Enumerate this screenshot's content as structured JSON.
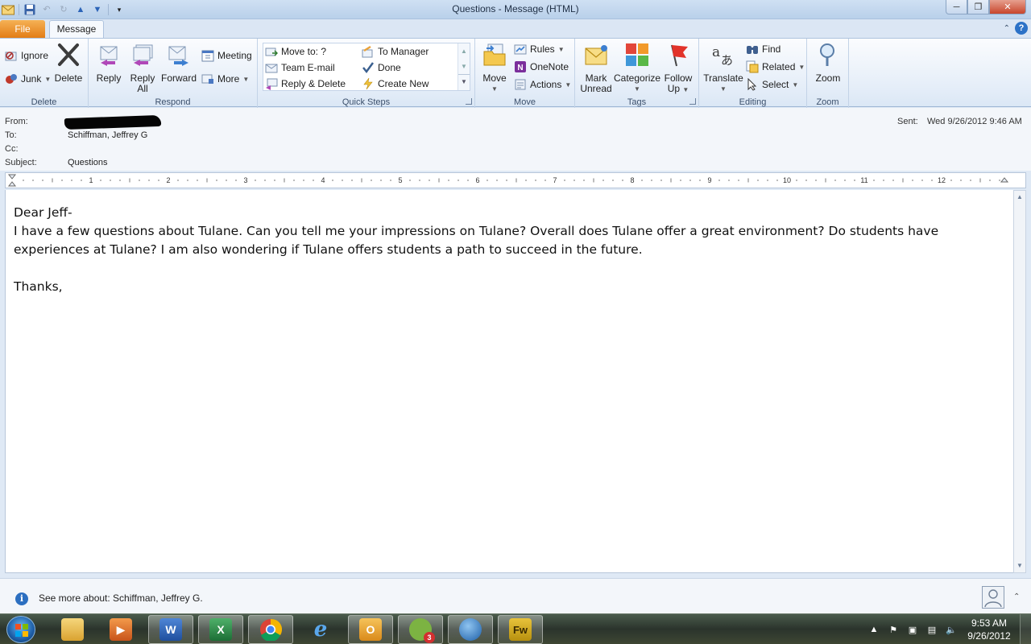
{
  "window": {
    "title": "Questions  -  Message (HTML)"
  },
  "tabs": {
    "file": "File",
    "message": "Message"
  },
  "ribbon": {
    "delete_group": {
      "label": "Delete",
      "ignore": "Ignore",
      "junk": "Junk",
      "delete": "Delete"
    },
    "respond_group": {
      "label": "Respond",
      "reply": "Reply",
      "reply_all_1": "Reply",
      "reply_all_2": "All",
      "forward": "Forward",
      "meeting": "Meeting",
      "more": "More"
    },
    "quick_steps_group": {
      "label": "Quick Steps",
      "items": [
        "Move to: ?",
        "To Manager",
        "Team E-mail",
        "Done",
        "Reply & Delete",
        "Create New"
      ]
    },
    "move_group": {
      "label": "Move",
      "move": "Move",
      "rules": "Rules",
      "onenote": "OneNote",
      "actions": "Actions"
    },
    "tags_group": {
      "label": "Tags",
      "mark_unread_1": "Mark",
      "mark_unread_2": "Unread",
      "categorize": "Categorize",
      "follow_up_1": "Follow",
      "follow_up_2": "Up"
    },
    "editing_group": {
      "label": "Editing",
      "translate": "Translate",
      "find": "Find",
      "related": "Related",
      "select": "Select"
    },
    "zoom_group": {
      "label": "Zoom",
      "zoom": "Zoom"
    }
  },
  "header": {
    "from_label": "From:",
    "to_label": "To:",
    "to_value": "Schiffman, Jeffrey G",
    "cc_label": "Cc:",
    "subject_label": "Subject:",
    "subject_value": "Questions",
    "sent_label": "Sent:",
    "sent_value": "Wed 9/26/2012 9:46 AM"
  },
  "ruler": {
    "numbers": [
      "1",
      "2",
      "3",
      "4",
      "5",
      "6",
      "7",
      "8",
      "9",
      "10",
      "11",
      "12"
    ]
  },
  "message_body": {
    "greeting": "Dear Jeff-",
    "paragraph": "I have a few questions about Tulane. Can you tell me your impressions on Tulane? Overall does Tulane offer a great environment? Do students have experiences at Tulane? I am also wondering if Tulane offers students a path to succeed in the future.",
    "closing": "Thanks,"
  },
  "people_pane": {
    "text": "See more about: Schiffman, Jeffrey G."
  },
  "taskbar": {
    "apps": [
      "windows-explorer",
      "media-player",
      "word",
      "excel",
      "chrome",
      "internet-explorer",
      "outlook",
      "spotify",
      "google-earth",
      "fireworks"
    ],
    "spotify_badge": "3",
    "fireworks_label": "Fw",
    "word_label": "W",
    "excel_label": "X",
    "clock_time": "9:53 AM",
    "clock_date": "9/26/2012"
  },
  "colors": {
    "file_tab": "#e37d16",
    "accent": "#2c72c7"
  }
}
